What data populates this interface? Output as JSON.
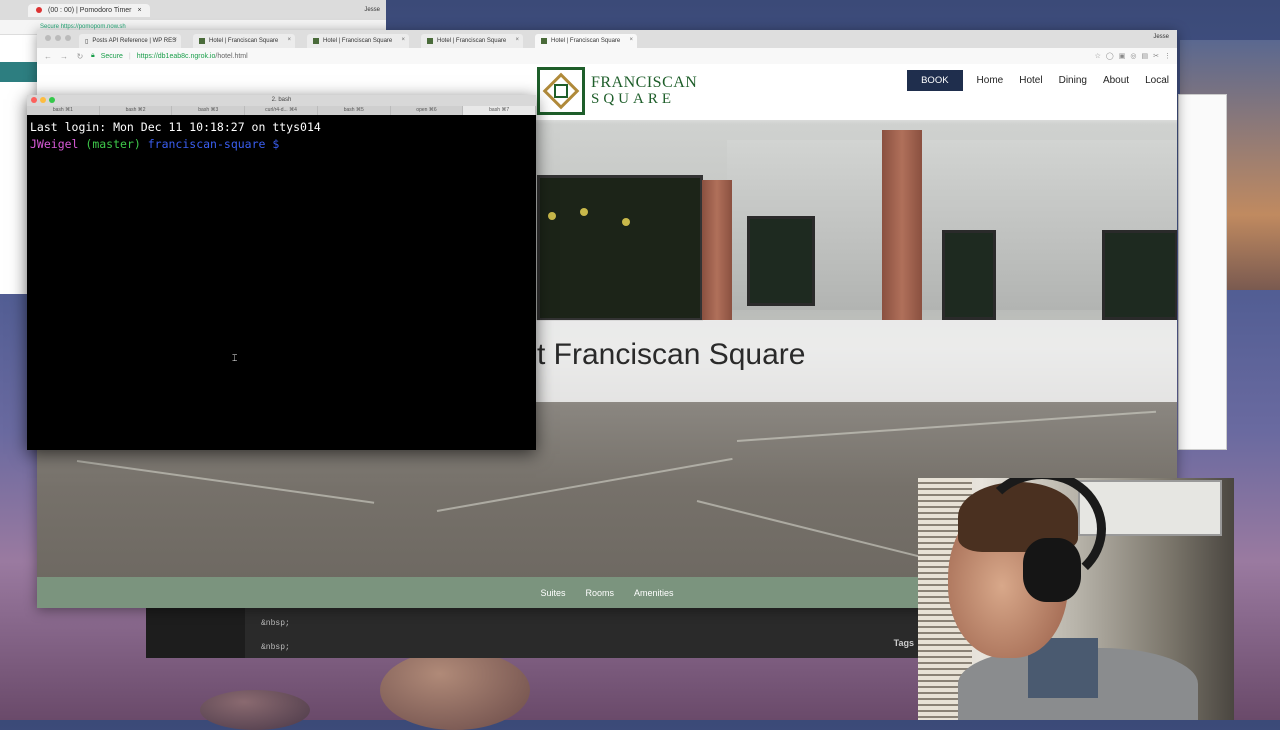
{
  "back_browser": {
    "tab_title": "(00 : 00) | Pomodoro Timer",
    "user": "Jesse",
    "secure_label": "Secure",
    "url": "https://pomopom.now.sh"
  },
  "browser": {
    "user": "Jesse",
    "tabs": [
      {
        "title": "Posts API Reference | WP RES"
      },
      {
        "title": "Hotel | Franciscan Square"
      },
      {
        "title": "Hotel | Franciscan Square"
      },
      {
        "title": "Hotel | Franciscan Square"
      },
      {
        "title": "Hotel | Franciscan Square"
      }
    ],
    "secure_label": "Secure",
    "url_host": "https://db1eab8c.ngrok.io",
    "url_path": "/hotel.html"
  },
  "site": {
    "logo_line1": "FRANCISCAN",
    "logo_line2": "SQUARE",
    "nav": {
      "book": "BOOK",
      "links": [
        "Home",
        "Hotel",
        "Dining",
        "About",
        "Local"
      ]
    },
    "hero_title": "t Franciscan Square",
    "subnav": [
      "Suites",
      "Rooms",
      "Amenities"
    ]
  },
  "terminal": {
    "title": "2. bash",
    "tabs": [
      "bash",
      "⌘1",
      "bash",
      "⌘2",
      "bash",
      "⌘3",
      "bash",
      "⌘4",
      "bash",
      "⌘5",
      "open",
      "⌘6",
      "bash",
      "⌘7"
    ],
    "tab_labels": [
      {
        "label": "bash",
        "key": "⌘1"
      },
      {
        "label": "bash",
        "key": "⌘2"
      },
      {
        "label": "bash",
        "key": "⌘3"
      },
      {
        "label": "curl/r4-d...",
        "key": "⌘4"
      },
      {
        "label": "bash",
        "key": "⌘5"
      },
      {
        "label": "open",
        "key": "⌘6"
      },
      {
        "label": "bash",
        "key": "⌘7"
      }
    ],
    "last_login": "Last login: Mon Dec 11 10:18:27 on ttys014",
    "prompt_user": "JWeigel",
    "prompt_branch": "(master)",
    "prompt_dir": "franciscan-square $"
  },
  "editor": {
    "lines": [
      "&nbsp;",
      "&nbsp;"
    ],
    "tags_label": "Tags"
  },
  "colors": {
    "book_bg": "#1f2e4d",
    "subnav_bg": "#7b947e",
    "logo_green": "#1e5e2a",
    "terminal_bg": "#000000"
  }
}
